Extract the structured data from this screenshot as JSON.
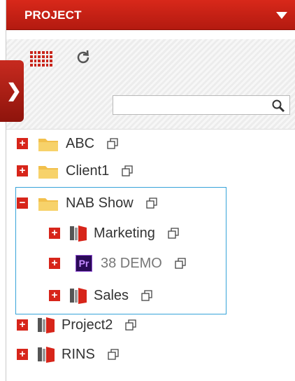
{
  "header": {
    "title": "PROJECT"
  },
  "toolbar": {
    "grid_icon": "grid-icon",
    "refresh_icon": "refresh-icon"
  },
  "search": {
    "value": "",
    "placeholder": ""
  },
  "sidebar_toggle": {
    "glyph": "❯"
  },
  "tree": {
    "rows": [
      {
        "label": "ABC",
        "icon": "folder-icon",
        "expander": "+"
      },
      {
        "label": "Client1",
        "icon": "folder-icon",
        "expander": "+"
      },
      {
        "label": "NAB Show",
        "icon": "folder-icon",
        "expander": "−"
      },
      {
        "label": "Marketing",
        "icon": "project-icon",
        "expander": "+"
      },
      {
        "label": "38 DEMO",
        "icon": "premiere-icon",
        "icon_text": "Pr",
        "expander": "+"
      },
      {
        "label": "Sales",
        "icon": "project-icon",
        "expander": "+"
      },
      {
        "label": "Project2",
        "icon": "project-icon",
        "expander": "+"
      },
      {
        "label": "RINS",
        "icon": "project-icon",
        "expander": "+"
      }
    ]
  },
  "colors": {
    "accent": "#d7251a",
    "selection": "#36a3d9",
    "folder": "#f2c04c"
  }
}
